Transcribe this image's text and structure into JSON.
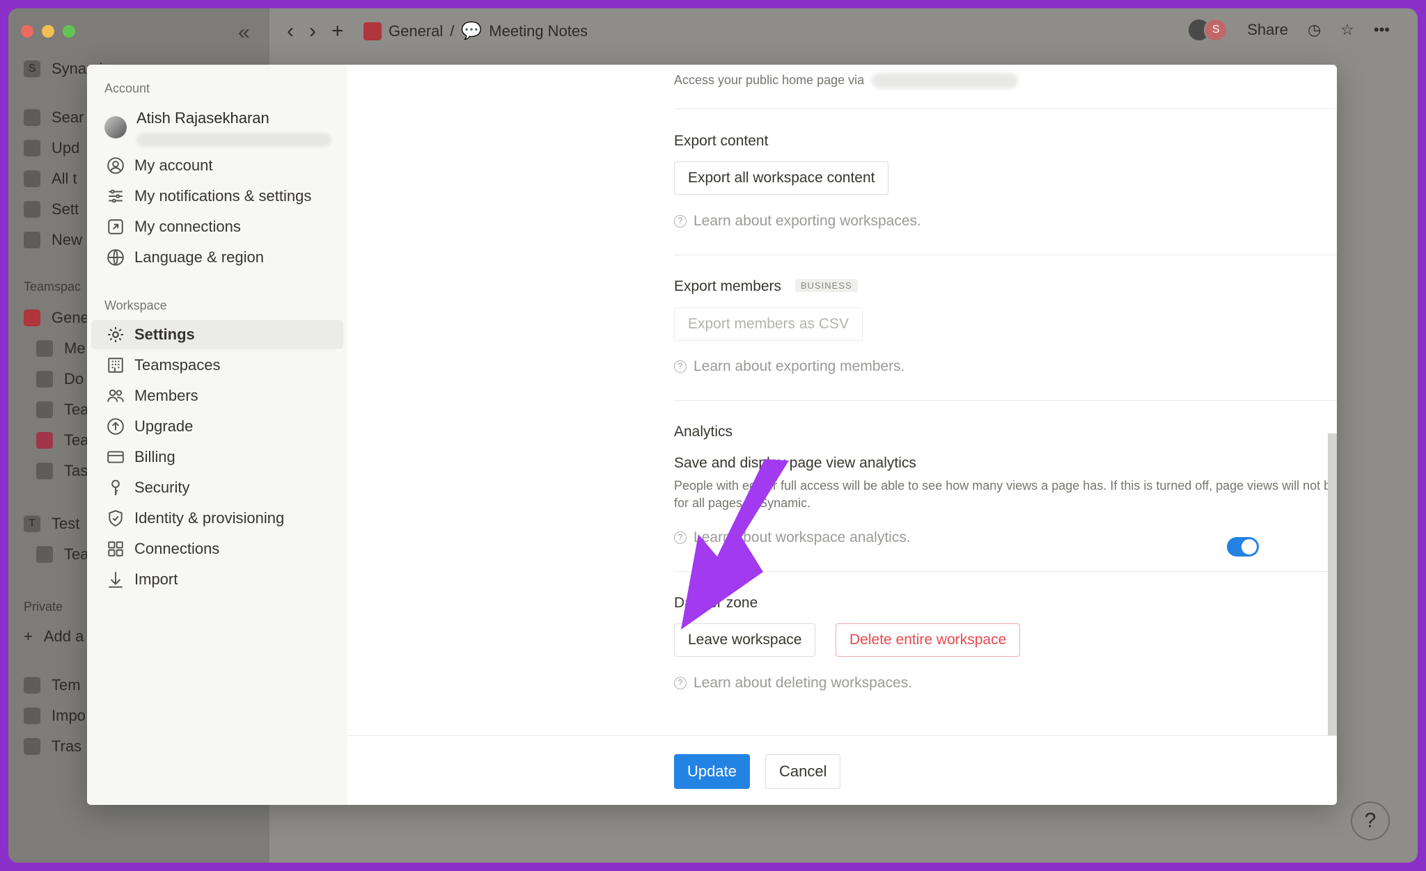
{
  "app": {
    "breadcrumb": [
      "General",
      "/",
      "Meeting Notes"
    ],
    "share_label": "Share",
    "workspace_short": "Synamic",
    "workspace_initial": "S",
    "sidebar_bg_items": [
      "Sear",
      "Upd",
      "All t",
      "Sett",
      "New"
    ],
    "sidebar_bg_sections": [
      "Teamspac",
      "Private"
    ],
    "sidebar_bg_pages": [
      "Gene",
      "Me",
      "Do",
      "Tea",
      "Tea",
      "Tas"
    ],
    "sidebar_bg_more": [
      "Test",
      "Tea",
      "Add a",
      "Tem",
      "Impo",
      "Tras"
    ],
    "test_initial": "T",
    "avatar_initial": "S",
    "help_label": "?"
  },
  "settings": {
    "account_label": "Account",
    "user_name": "Atish Rajasekharan",
    "account_items": [
      "My account",
      "My notifications & settings",
      "My connections",
      "Language & region"
    ],
    "workspace_label": "Workspace",
    "workspace_items": [
      "Settings",
      "Teamspaces",
      "Members",
      "Upgrade",
      "Billing",
      "Security",
      "Identity & provisioning",
      "Connections",
      "Import"
    ],
    "active_item": "Settings"
  },
  "content": {
    "public_home": "Access your public home page via",
    "export_content_title": "Export content",
    "export_all_button": "Export all workspace content",
    "export_learn": "Learn about exporting workspaces.",
    "export_members_title": "Export members",
    "business_badge": "BUSINESS",
    "export_members_button": "Export members as CSV",
    "members_learn": "Learn about exporting members.",
    "analytics_title": "Analytics",
    "analytics_setting": "Save and display page view analytics",
    "analytics_desc": "People with edit or full access will be able to see how many views a page has. If this is turned off, page views will not be stored for all pages in Synamic.",
    "analytics_learn": "Learn about workspace analytics.",
    "analytics_enabled": true,
    "danger_title": "Danger zone",
    "leave_button": "Leave workspace",
    "delete_button": "Delete entire workspace",
    "delete_learn": "Learn about deleting workspaces."
  },
  "footer": {
    "update_button": "Update",
    "cancel_button": "Cancel"
  },
  "colors": {
    "accent": "#2383e2",
    "danger": "#e5484d",
    "annotation_arrow": "#a23af0",
    "frame": "#8a2fc7"
  }
}
